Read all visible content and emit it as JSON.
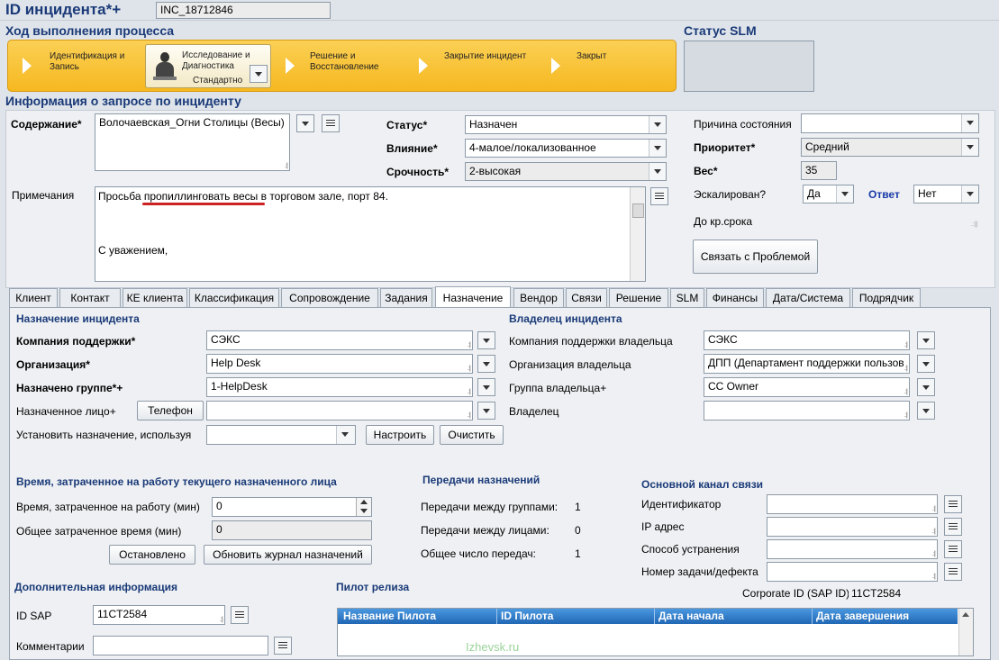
{
  "header": {
    "title": "ID инцидента*+",
    "incident_id": "INC_18712846"
  },
  "process": {
    "title": "Ход выполнения процесса",
    "steps": [
      {
        "line1": "Идентификация и",
        "line2": "Запись"
      },
      {
        "line1": "Исследование и",
        "line2": "Диагностика",
        "line3": "Стандартно"
      },
      {
        "line1": "Решение и",
        "line2": "Восстановление"
      },
      {
        "line1": "Закрытие инцидент",
        "line2": ""
      },
      {
        "line1": "Закрыт",
        "line2": ""
      }
    ]
  },
  "slm": {
    "title": "Статус SLM"
  },
  "info": {
    "title": "Информация о запросе по инциденту",
    "content_label": "Содержание*",
    "content_value": "Волочаевская_Огни Столицы (Весы)",
    "notes_label": "Примечания",
    "notes_line1": "Просьба пропиллинговать весы в торговом зале, порт 84.",
    "notes_line2": "С уважением,",
    "status_label": "Статус*",
    "status_value": "Назначен",
    "impact_label": "Влияние*",
    "impact_value": "4-малое/локализованное",
    "urgency_label": "Срочность*",
    "urgency_value": "2-высокая",
    "reason_label": "Причина состояния",
    "reason_value": "",
    "priority_label": "Приоритет*",
    "priority_value": "Средний",
    "weight_label": "Вес*",
    "weight_value": "35",
    "escalated_label": "Эскалирован?",
    "escalated_value": "Да",
    "answer_label": "Ответ",
    "answer_value": "Нет",
    "deadline_label": "До кр.срока",
    "link_problem_button": "Связать с Проблемой"
  },
  "tabs": [
    "Клиент",
    "Контакт",
    "КЕ клиента",
    "Классификация",
    "Сопровождение",
    "Задания",
    "Назначение",
    "Вендор",
    "Связи",
    "Решение",
    "SLM",
    "Финансы",
    "Дата/Система",
    "Подрядчик"
  ],
  "assignment": {
    "title": "Назначение инцидента",
    "company_label": "Компания поддержки*",
    "company_value": "СЭКС",
    "org_label": "Организация*",
    "org_value": "Help Desk",
    "group_label": "Назначено группе*+",
    "group_value": "1-HelpDesk",
    "person_label": "Назначенное лицо+",
    "phone_button": "Телефон",
    "person_value": "",
    "set_using_label": "Установить назначение, используя",
    "configure_button": "Настроить",
    "clear_button": "Очистить"
  },
  "owner": {
    "title": "Владелец инцидента",
    "company_label": "Компания поддержки владельца",
    "company_value": "СЭКС",
    "org_label": "Организация владельца",
    "org_value": "ДПП (Департамент поддержки пользов",
    "group_label": "Группа владельца+",
    "group_value": "CC Owner",
    "owner_label": "Владелец",
    "owner_value": ""
  },
  "time": {
    "title": "Время, затраченное на работу текущего назначенного лица",
    "work_label": "Время, затраченное на работу (мин)",
    "work_value": "0",
    "total_label": "Общее затраченное время (мин)",
    "total_value": "0",
    "stopped_button": "Остановлено",
    "refresh_button": "Обновить журнал назначений"
  },
  "transfers": {
    "title": "Передачи назначений",
    "groups_label": "Передачи между группами:",
    "groups_value": "1",
    "persons_label": "Передачи между лицами:",
    "persons_value": "0",
    "total_label": "Общее число передач:",
    "total_value": "1"
  },
  "channel": {
    "title": "Основной канал связи",
    "identifier_label": "Идентификатор",
    "ip_label": "IP адрес",
    "fix_label": "Способ устранения",
    "task_label": "Номер задачи/дефекта",
    "corporate_label": "Corporate ID (SAP ID)",
    "corporate_value": "11CT2584"
  },
  "additional": {
    "title": "Дополнительная информация",
    "sap_label": "ID SAP",
    "sap_value": "11CT2584",
    "comments_label": "Комментарии"
  },
  "pilot": {
    "title": "Пилот релиза",
    "columns": [
      "Название Пилота",
      "ID Пилота",
      "Дата начала",
      "Дата завершения"
    ]
  },
  "watermark": "Izhevsk.ru",
  "colors": {
    "accent": "#1a3a78",
    "process_bg": "#f6b820",
    "table_header": "#2e7fcc",
    "underline": "#cc2222"
  }
}
